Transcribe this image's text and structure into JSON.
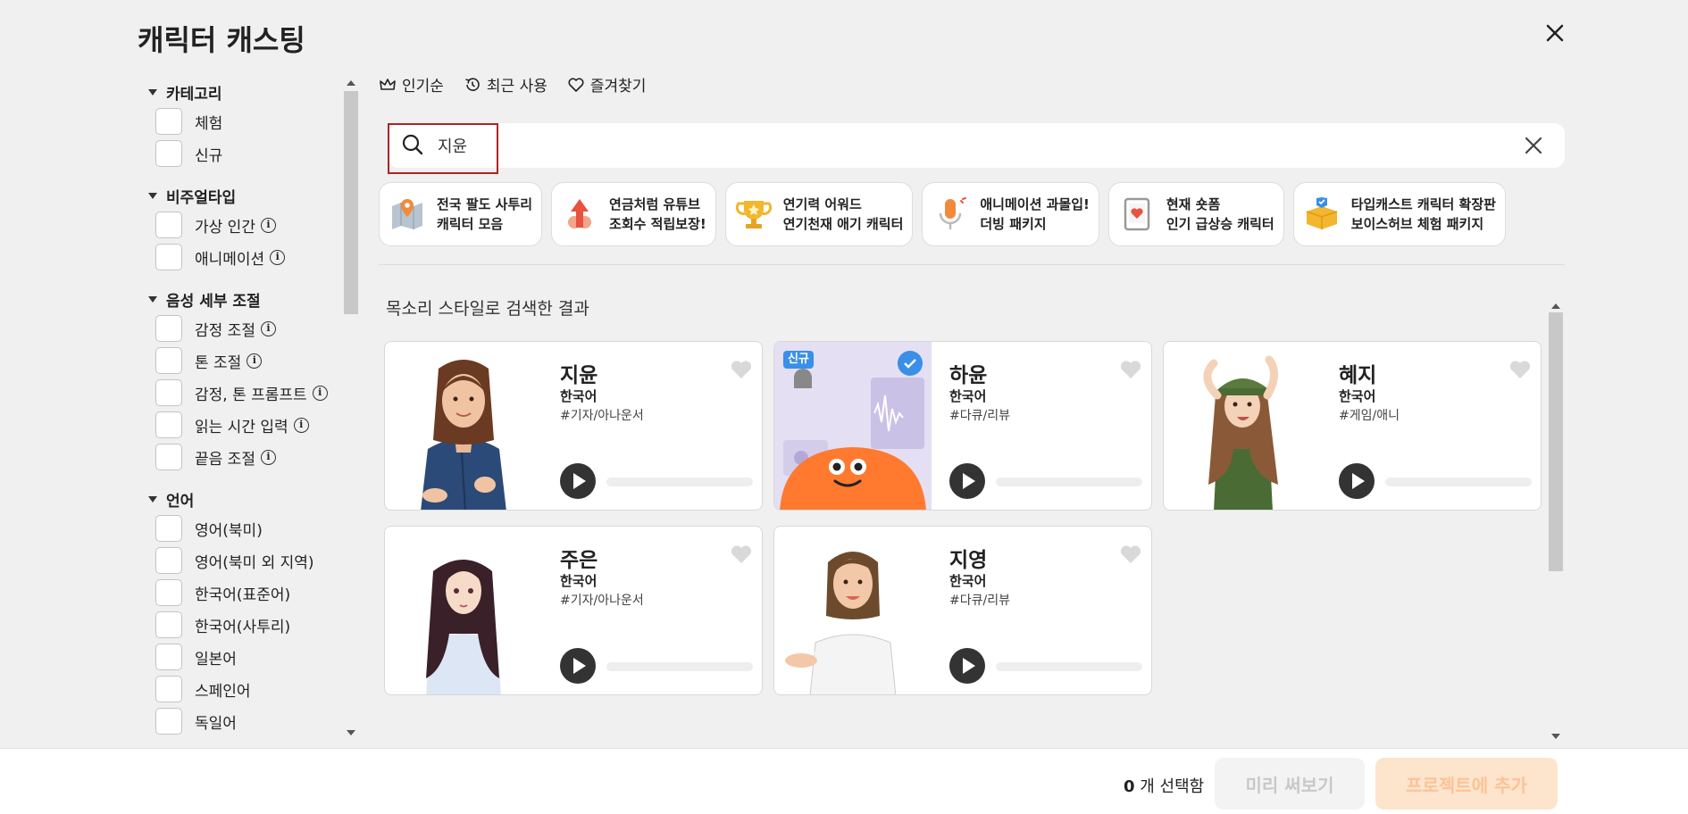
{
  "header": {
    "title": "캐릭터 캐스팅"
  },
  "sidebar": {
    "sections": [
      {
        "label": "카테고리",
        "options": [
          {
            "label": "체험",
            "info": false
          },
          {
            "label": "신규",
            "info": false
          }
        ]
      },
      {
        "label": "비주얼타입",
        "options": [
          {
            "label": "가상 인간",
            "info": true
          },
          {
            "label": "애니메이션",
            "info": true
          }
        ]
      },
      {
        "label": "음성 세부 조절",
        "options": [
          {
            "label": "감정 조절",
            "info": true
          },
          {
            "label": "톤 조절",
            "info": true
          },
          {
            "label": "감정, 톤 프롬프트",
            "info": true
          },
          {
            "label": "읽는 시간 입력",
            "info": true
          },
          {
            "label": "끝음 조절",
            "info": true
          }
        ]
      },
      {
        "label": "언어",
        "options": [
          {
            "label": "영어(북미)",
            "info": false
          },
          {
            "label": "영어(북미 외 지역)",
            "info": false
          },
          {
            "label": "한국어(표준어)",
            "info": false
          },
          {
            "label": "한국어(사투리)",
            "info": false
          },
          {
            "label": "일본어",
            "info": false
          },
          {
            "label": "스페인어",
            "info": false
          },
          {
            "label": "독일어",
            "info": false
          }
        ]
      }
    ]
  },
  "tabs": [
    {
      "label": "인기순",
      "icon": "crown-icon"
    },
    {
      "label": "최근 사용",
      "icon": "history-icon"
    },
    {
      "label": "즐겨찾기",
      "icon": "heart-icon"
    }
  ],
  "search": {
    "value": "지윤",
    "placeholder": ""
  },
  "banners": [
    {
      "line1": "전국 팔도 사투리",
      "line2": "캐릭터 모음",
      "icon": "map-pin-icon"
    },
    {
      "line1": "연금처럼 유튜브",
      "line2": "조회수 적립보장!",
      "icon": "growth-arrow-icon"
    },
    {
      "line1": "연기력 어워드",
      "line2": "연기천재 애기 캐릭터",
      "icon": "trophy-icon"
    },
    {
      "line1": "애니메이션 과몰입!",
      "line2": "더빙 패키지",
      "icon": "microphone-icon"
    },
    {
      "line1": "현재 숏폼",
      "line2": "인기 급상승 캐릭터",
      "icon": "tablet-heart-icon"
    },
    {
      "line1": "타입캐스트 캐릭터 확장판",
      "line2": "보이스허브 체험 패키지",
      "icon": "gift-box-icon"
    }
  ],
  "results": {
    "title": "목소리 스타일로 검색한 결과",
    "cards": [
      {
        "name": "지윤",
        "lang": "한국어",
        "tag": "#기자/아나운서",
        "portrait": "woman-denim-shirt"
      },
      {
        "name": "하윤",
        "lang": "한국어",
        "tag": "#다큐/리뷰",
        "portrait": "orange-mascot",
        "badge": "신규"
      },
      {
        "name": "혜지",
        "lang": "한국어",
        "tag": "#게임/애니",
        "portrait": "anime-soldier-girl"
      },
      {
        "name": "주은",
        "lang": "한국어",
        "tag": "#기자/아나운서",
        "portrait": "anime-woman-blouse"
      },
      {
        "name": "지영",
        "lang": "한국어",
        "tag": "#다큐/리뷰",
        "portrait": "woman-white-shirt"
      }
    ]
  },
  "footer": {
    "count": "0",
    "count_suffix": " 개 선택함",
    "preview_label": "미리 써보기",
    "add_label": "프로젝트에 추가"
  },
  "colors": {
    "accent": "#ff7a2f",
    "highlight_border": "#b22222",
    "add_button_bg": "#fde4cc"
  }
}
